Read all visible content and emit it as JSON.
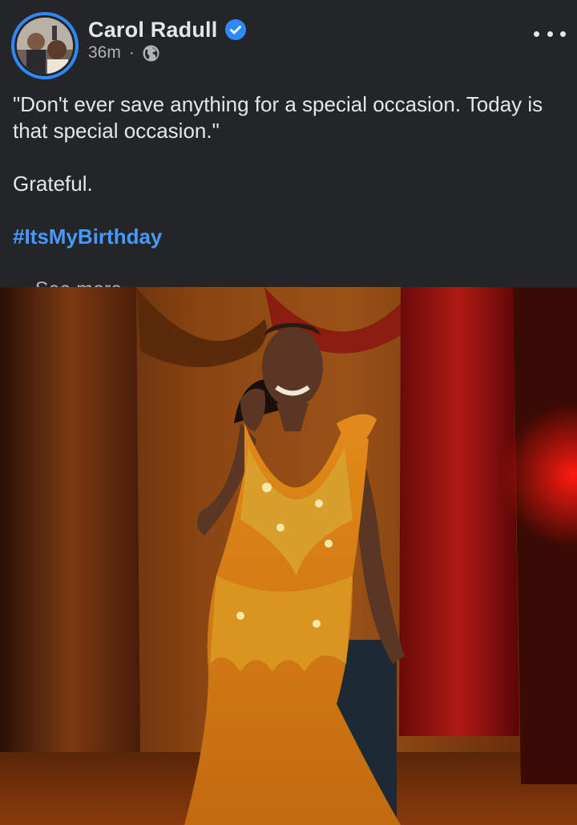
{
  "post": {
    "author": {
      "name": "Carol Radull",
      "verified": true
    },
    "meta": {
      "time": "36m",
      "separator": "·",
      "audience_icon": "globe-icon"
    },
    "menu_icon": "more-options-icon",
    "text": {
      "quote": "\"Don't ever save anything for a special occasion. Today is that special occasion.\"",
      "line2": "Grateful.",
      "hashtag": "#ItsMyBirthday",
      "see_more": "... See more"
    },
    "photo": {
      "subject": "woman in gold sequined gown"
    }
  },
  "colors": {
    "background": "#242526",
    "primary_text": "#e4e6eb",
    "secondary_text": "#b0b3b8",
    "accent_blue": "#4599ff",
    "verified_blue": "#2e89ff"
  }
}
